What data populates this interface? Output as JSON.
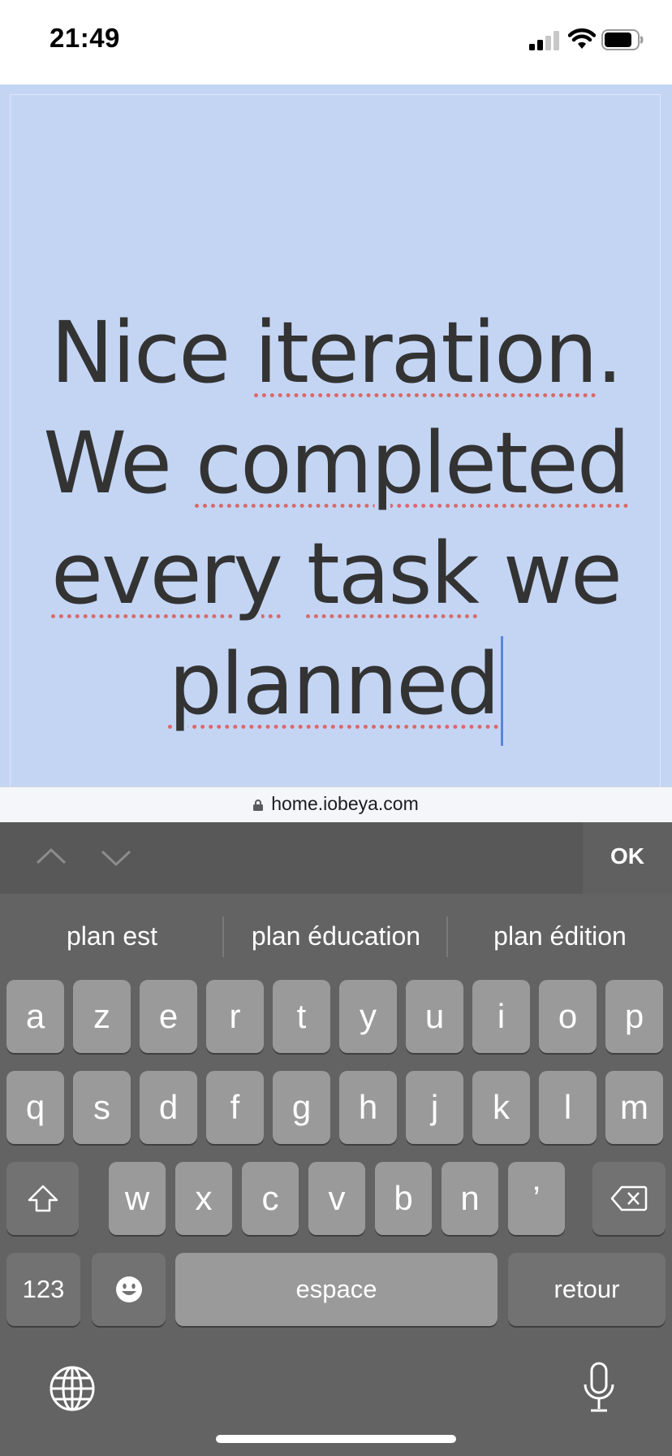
{
  "status_bar": {
    "time": "21:49"
  },
  "note": {
    "lines": [
      [
        {
          "text": "Nice "
        },
        {
          "text": "iteration",
          "misspelled": true
        },
        {
          "text": "."
        }
      ],
      [
        {
          "text": "We "
        },
        {
          "text": "completed",
          "misspelled": true
        }
      ],
      [
        {
          "text": "every",
          "misspelled": true
        },
        {
          "text": " "
        },
        {
          "text": "task",
          "misspelled": true
        },
        {
          "text": " we"
        }
      ],
      [
        {
          "text": "planned",
          "misspelled": true
        }
      ]
    ],
    "background_color": "#c4d5f4"
  },
  "browser": {
    "url": "home.iobeya.com"
  },
  "toolbar": {
    "ok_label": "OK"
  },
  "keyboard": {
    "suggestions": [
      "plan est",
      "plan éducation",
      "plan édition"
    ],
    "row1": [
      "a",
      "z",
      "e",
      "r",
      "t",
      "y",
      "u",
      "i",
      "o",
      "p"
    ],
    "row2": [
      "q",
      "s",
      "d",
      "f",
      "g",
      "h",
      "j",
      "k",
      "l",
      "m"
    ],
    "row3": [
      "w",
      "x",
      "c",
      "v",
      "b",
      "n",
      "’"
    ],
    "numbers_label": "123",
    "space_label": "espace",
    "return_label": "retour",
    "icons": [
      "shift-icon",
      "backspace-icon",
      "emoji-icon",
      "globe-icon",
      "microphone-icon"
    ]
  }
}
